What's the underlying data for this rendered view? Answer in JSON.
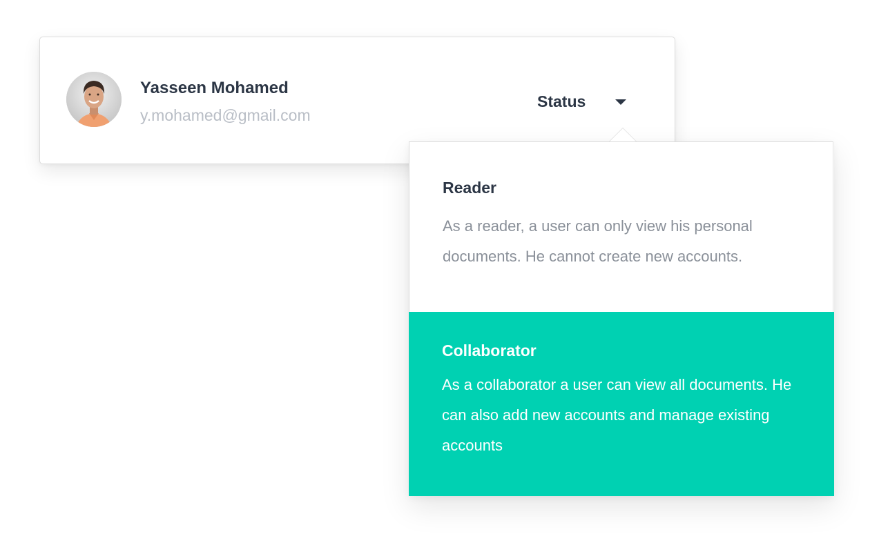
{
  "user": {
    "name": "Yasseen Mohamed",
    "email": "y.mohamed@gmail.com",
    "avatar_icon": "user-avatar-photo"
  },
  "status": {
    "label": "Status",
    "caret_icon": "chevron-down-icon"
  },
  "dropdown": {
    "options": [
      {
        "title": "Reader",
        "description": "As a reader, a user can only view his personal documents. He cannot create new accounts.",
        "selected": false
      },
      {
        "title": "Collaborator",
        "description": "As a collaborator a user can view all documents. He can also add new accounts and manage existing accounts",
        "selected": true
      }
    ]
  },
  "colors": {
    "accent": "#00d1b2",
    "heading": "#2c3645",
    "muted": "#8a9099",
    "email": "#b9bec6"
  }
}
